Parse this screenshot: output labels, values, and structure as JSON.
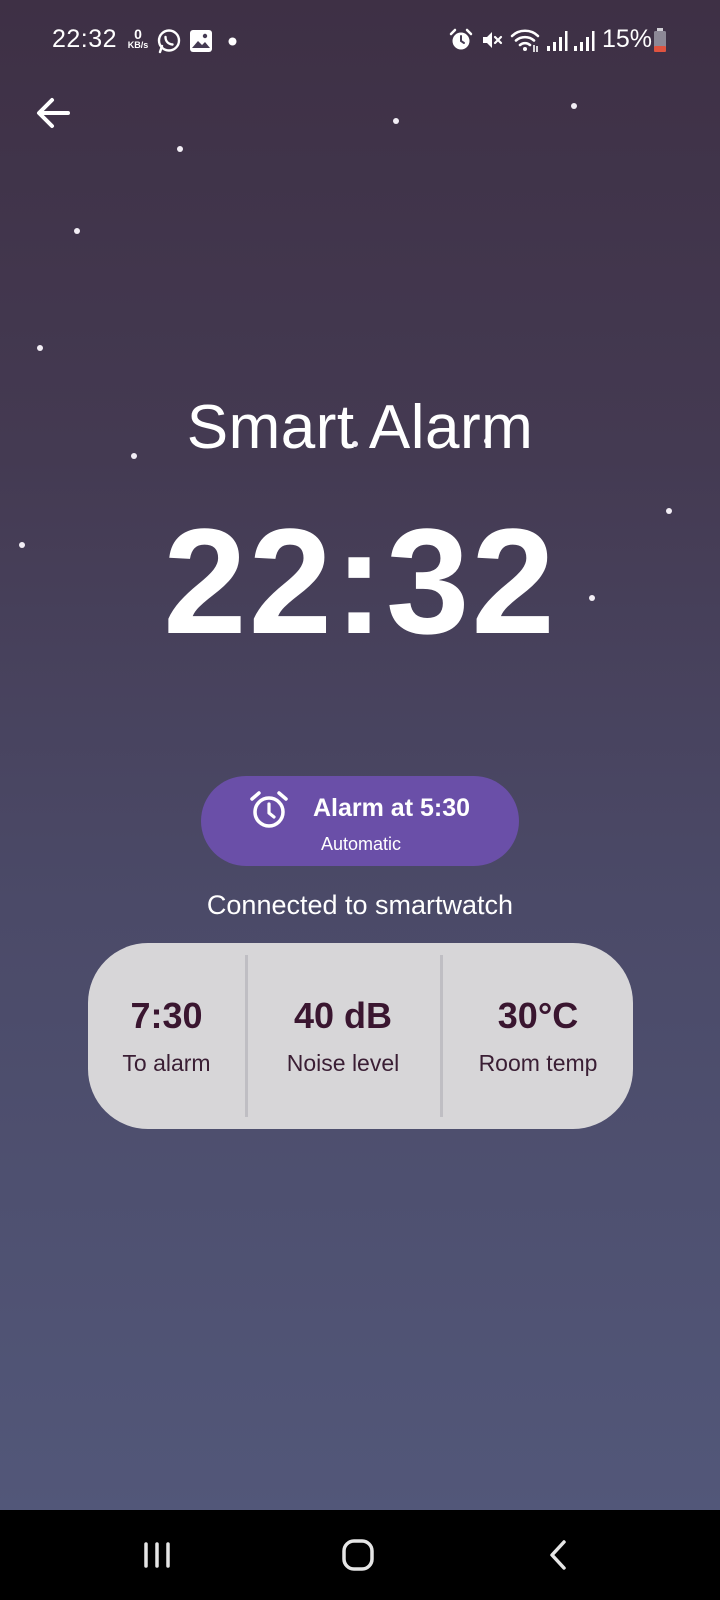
{
  "status_bar": {
    "time": "22:32",
    "net_speed_value": "0",
    "net_speed_unit": "KB/s",
    "battery": "15%",
    "icons": [
      "whatsapp-icon",
      "gallery-icon",
      "dot-icon",
      "alarm-icon",
      "mute-icon",
      "wifi-icon",
      "signal-icon",
      "signal-icon",
      "battery-icon"
    ]
  },
  "header": {
    "back_icon": "arrow-left-icon"
  },
  "main": {
    "title": "Smart Alarm",
    "current_time": "22:32",
    "alarm": {
      "label": "Alarm at 5:30",
      "mode": "Automatic",
      "icon": "alarm-clock-icon",
      "color": "#6a4fa8"
    },
    "connection_status": "Connected to smartwatch",
    "stats": [
      {
        "value": "7:30",
        "label": "To alarm"
      },
      {
        "value": "40 dB",
        "label": "Noise level"
      },
      {
        "value": "30°C",
        "label": "Room temp"
      }
    ]
  },
  "nav_bar": {
    "icons": [
      "recents-icon",
      "home-icon",
      "back-icon"
    ]
  }
}
